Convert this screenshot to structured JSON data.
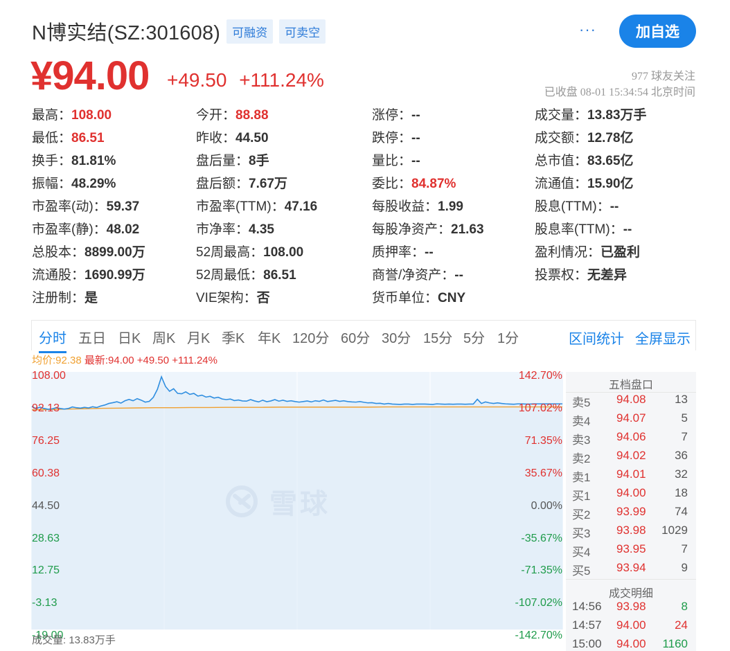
{
  "header": {
    "title": "N博实结(SZ:301608)",
    "tags": [
      "可融资",
      "可卖空"
    ],
    "more_label": "···",
    "add_button": "加自选"
  },
  "quote": {
    "price": "¥94.00",
    "change": "+49.50",
    "change_pct": "+111.24%",
    "followers": "977 球友关注",
    "status": "已收盘 08-01 15:34:54 北京时间"
  },
  "stats": [
    [
      {
        "label": "最高：",
        "value": "108.00",
        "tone": "red"
      },
      {
        "label": "今开：",
        "value": "88.88",
        "tone": "red"
      },
      {
        "label": "涨停：",
        "value": "--",
        "tone": ""
      },
      {
        "label": "成交量：",
        "value": "13.83万手",
        "tone": ""
      }
    ],
    [
      {
        "label": "最低：",
        "value": "86.51",
        "tone": "red"
      },
      {
        "label": "昨收：",
        "value": "44.50",
        "tone": ""
      },
      {
        "label": "跌停：",
        "value": "--",
        "tone": ""
      },
      {
        "label": "成交额：",
        "value": "12.78亿",
        "tone": ""
      }
    ],
    [
      {
        "label": "换手：",
        "value": "81.81%",
        "tone": ""
      },
      {
        "label": "盘后量：",
        "value": "8手",
        "tone": ""
      },
      {
        "label": "量比：",
        "value": "--",
        "tone": ""
      },
      {
        "label": "总市值：",
        "value": "83.65亿",
        "tone": ""
      }
    ],
    [
      {
        "label": "振幅：",
        "value": "48.29%",
        "tone": ""
      },
      {
        "label": "盘后额：",
        "value": "7.67万",
        "tone": ""
      },
      {
        "label": "委比：",
        "value": "84.87%",
        "tone": "red"
      },
      {
        "label": "流通值：",
        "value": "15.90亿",
        "tone": ""
      }
    ],
    [
      {
        "label": "市盈率(动)：",
        "value": "59.37",
        "tone": ""
      },
      {
        "label": "市盈率(TTM)：",
        "value": "47.16",
        "tone": ""
      },
      {
        "label": "每股收益：",
        "value": "1.99",
        "tone": ""
      },
      {
        "label": "股息(TTM)：",
        "value": "--",
        "tone": ""
      }
    ],
    [
      {
        "label": "市盈率(静)：",
        "value": "48.02",
        "tone": ""
      },
      {
        "label": "市净率：",
        "value": "4.35",
        "tone": ""
      },
      {
        "label": "每股净资产：",
        "value": "21.63",
        "tone": ""
      },
      {
        "label": "股息率(TTM)：",
        "value": "--",
        "tone": ""
      }
    ],
    [
      {
        "label": "总股本：",
        "value": "8899.00万",
        "tone": ""
      },
      {
        "label": "52周最高：",
        "value": "108.00",
        "tone": ""
      },
      {
        "label": "质押率：",
        "value": "--",
        "tone": ""
      },
      {
        "label": "盈利情况：",
        "value": "已盈利",
        "tone": ""
      }
    ],
    [
      {
        "label": "流通股：",
        "value": "1690.99万",
        "tone": ""
      },
      {
        "label": "52周最低：",
        "value": "86.51",
        "tone": ""
      },
      {
        "label": "商誉/净资产：",
        "value": "--",
        "tone": ""
      },
      {
        "label": "投票权：",
        "value": "无差异",
        "tone": ""
      }
    ],
    [
      {
        "label": "注册制：",
        "value": "是",
        "tone": ""
      },
      {
        "label": "VIE架构：",
        "value": "否",
        "tone": ""
      },
      {
        "label": "货币单位：",
        "value": "CNY",
        "tone": ""
      }
    ]
  ],
  "tabs": [
    "分时",
    "五日",
    "日K",
    "周K",
    "月K",
    "季K",
    "年K",
    "120分",
    "60分",
    "30分",
    "15分",
    "5分",
    "1分"
  ],
  "active_tab": "分时",
  "tab_actions": [
    "区间统计",
    "全屏显示"
  ],
  "legend": {
    "avg": "均价:92.38",
    "latest": "最新:94.00 +49.50 +111.24%"
  },
  "chart_data": {
    "type": "line",
    "title": "",
    "y_left_ticks": [
      "108.00",
      "92.13",
      "76.25",
      "60.38",
      "44.50",
      "28.63",
      "12.75",
      "-3.13",
      "-19.00"
    ],
    "y_right_ticks": [
      "142.70%",
      "107.02%",
      "71.35%",
      "35.67%",
      "0.00%",
      "-35.67%",
      "-71.35%",
      "-107.02%",
      "-142.70%"
    ],
    "ylim": [
      -19.0,
      108.0
    ],
    "prev_close": 44.5,
    "series": [
      {
        "values": [
          92.7,
          91.5,
          92.3,
          91.6,
          91.2,
          91.4,
          92.0,
          91.6,
          91.3,
          91.6,
          92.4,
          92.0,
          91.8,
          92.2,
          91.9,
          92.5,
          92.1,
          92.9,
          93.4,
          94.2,
          94.6,
          95.1,
          94.4,
          95.6,
          96.3,
          95.6,
          96.7,
          95.9,
          94.9,
          95.3,
          97.4,
          101.5,
          108.0,
          103.0,
          100.5,
          101.8,
          99.4,
          99.2,
          100.2,
          98.9,
          99.4,
          98.0,
          98.5,
          97.5,
          97.9,
          97.0,
          97.4,
          96.5,
          96.2,
          96.5,
          95.7,
          96.0,
          95.5,
          95.4,
          96.2,
          95.5,
          95.0,
          95.9,
          95.1,
          95.5,
          96.2,
          95.4,
          95.9,
          95.3,
          95.6,
          95.2,
          94.9,
          95.2,
          95.5,
          95.0,
          95.6,
          95.3,
          96.0,
          95.2,
          95.5,
          95.8,
          95.3,
          95.6,
          95.2,
          95.0,
          94.9,
          95.2,
          94.8,
          94.5,
          94.6,
          94.2,
          94.3,
          93.9,
          94.2,
          93.9,
          93.8,
          93.7,
          93.9,
          93.9,
          93.7,
          93.9,
          93.9,
          93.9,
          93.8,
          93.7,
          94.0,
          93.9,
          93.8,
          93.9,
          93.8,
          93.9,
          93.9,
          93.8,
          93.9,
          93.9,
          96.4,
          94.2,
          95.0,
          94.5,
          94.2,
          94.5,
          94.2,
          94.0,
          93.9,
          93.8,
          94.0,
          94.0,
          93.9,
          93.9,
          94.0,
          94.0,
          94.0,
          94.0,
          94.0,
          94.0,
          94.0,
          94.0
        ]
      },
      {
        "values": [
          90.9,
          91.1,
          91.3,
          91.5,
          91.7,
          91.8,
          91.9,
          92.0,
          92.0,
          92.1,
          92.1,
          92.2,
          92.2,
          92.2,
          92.3,
          92.3,
          92.3,
          92.3,
          92.3,
          92.3,
          92.4,
          92.4,
          92.4,
          92.4,
          92.4,
          92.4,
          92.4,
          92.4,
          92.4,
          92.4,
          92.4
        ]
      }
    ]
  },
  "watermark": "雪球",
  "volume_label": "成交量: 13.83万手",
  "order_book": {
    "title": "五档盘口",
    "asks": [
      {
        "name": "卖5",
        "price": "94.08",
        "qty": "13"
      },
      {
        "name": "卖4",
        "price": "94.07",
        "qty": "5"
      },
      {
        "name": "卖3",
        "price": "94.06",
        "qty": "7"
      },
      {
        "name": "卖2",
        "price": "94.02",
        "qty": "36"
      },
      {
        "name": "卖1",
        "price": "94.01",
        "qty": "32"
      }
    ],
    "bids": [
      {
        "name": "买1",
        "price": "94.00",
        "qty": "18"
      },
      {
        "name": "买2",
        "price": "93.99",
        "qty": "74"
      },
      {
        "name": "买3",
        "price": "93.98",
        "qty": "1029"
      },
      {
        "name": "买4",
        "price": "93.95",
        "qty": "7"
      },
      {
        "name": "买5",
        "price": "93.94",
        "qty": "9"
      }
    ]
  },
  "trades": {
    "title": "成交明细",
    "rows": [
      {
        "time": "14:56",
        "price": "93.98",
        "vol": "8",
        "dir": "buy"
      },
      {
        "time": "14:57",
        "price": "94.00",
        "vol": "24",
        "dir": "sell"
      },
      {
        "time": "15:00",
        "price": "94.00",
        "vol": "1160",
        "dir": "buy"
      }
    ]
  },
  "colors": {
    "up": "#e0312f",
    "down": "#1e9b4a",
    "accent": "#1a83e8",
    "price_line": "#2f8ee0",
    "avg_line": "#f0a030"
  }
}
